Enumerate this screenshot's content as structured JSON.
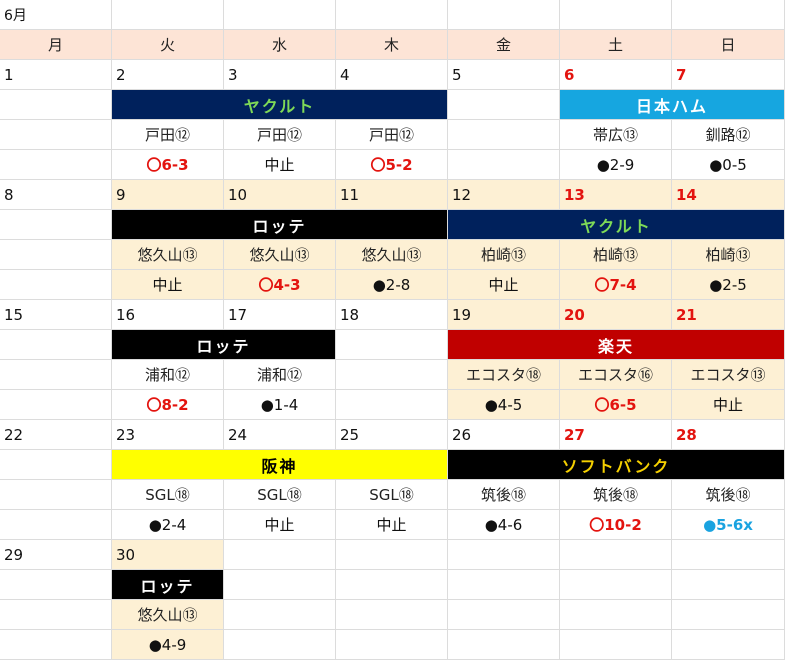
{
  "month_label": "6月",
  "weekdays": [
    "月",
    "火",
    "水",
    "木",
    "金",
    "土",
    "日"
  ],
  "colors": {
    "header_bg": "#fde4d6",
    "home_bg": "#fdf0d4",
    "weekend_date": "#e3140f",
    "win": "#e3140f",
    "loss": "#111111",
    "special": "#1aa3e0"
  },
  "weeks": [
    {
      "dates": [
        {
          "day": "1",
          "weekend": false,
          "home": false
        },
        {
          "day": "2",
          "weekend": false,
          "home": false
        },
        {
          "day": "3",
          "weekend": false,
          "home": false
        },
        {
          "day": "4",
          "weekend": false,
          "home": false
        },
        {
          "day": "5",
          "weekend": false,
          "home": false
        },
        {
          "day": "6",
          "weekend": true,
          "home": false
        },
        {
          "day": "7",
          "weekend": true,
          "home": false
        }
      ],
      "bands": [
        {
          "start": 1,
          "span": 3,
          "name": "ヤクルト",
          "bg": "#00215c",
          "fg": "#7ed957"
        },
        {
          "start": 5,
          "span": 2,
          "name": "日本ハム",
          "bg": "#16a6e0",
          "fg": "#ffffff"
        }
      ],
      "games": [
        {
          "col": 1,
          "venue": "戸田⑫",
          "result": "〇6-3",
          "kind": "win",
          "home": false
        },
        {
          "col": 2,
          "venue": "戸田⑫",
          "result": "中止",
          "kind": "stop",
          "home": false
        },
        {
          "col": 3,
          "venue": "戸田⑫",
          "result": "〇5-2",
          "kind": "win",
          "home": false
        },
        {
          "col": 5,
          "venue": "帯広⑬",
          "result": "●2-9",
          "kind": "loss",
          "home": false
        },
        {
          "col": 6,
          "venue": "釧路⑫",
          "result": "●0-5",
          "kind": "loss",
          "home": false
        }
      ]
    },
    {
      "dates": [
        {
          "day": "8",
          "weekend": false,
          "home": false
        },
        {
          "day": "9",
          "weekend": false,
          "home": true
        },
        {
          "day": "10",
          "weekend": false,
          "home": true
        },
        {
          "day": "11",
          "weekend": false,
          "home": true
        },
        {
          "day": "12",
          "weekend": false,
          "home": true
        },
        {
          "day": "13",
          "weekend": true,
          "home": true
        },
        {
          "day": "14",
          "weekend": true,
          "home": true
        }
      ],
      "bands": [
        {
          "start": 1,
          "span": 3,
          "name": "ロッテ",
          "bg": "#000000",
          "fg": "#ffffff"
        },
        {
          "start": 4,
          "span": 3,
          "name": "ヤクルト",
          "bg": "#00215c",
          "fg": "#7ed957"
        }
      ],
      "games": [
        {
          "col": 1,
          "venue": "悠久山⑬",
          "result": "中止",
          "kind": "stop",
          "home": true
        },
        {
          "col": 2,
          "venue": "悠久山⑬",
          "result": "〇4-3",
          "kind": "win",
          "home": true
        },
        {
          "col": 3,
          "venue": "悠久山⑬",
          "result": "●2-8",
          "kind": "loss",
          "home": true
        },
        {
          "col": 4,
          "venue": "柏崎⑬",
          "result": "中止",
          "kind": "stop",
          "home": true
        },
        {
          "col": 5,
          "venue": "柏崎⑬",
          "result": "〇7-4",
          "kind": "win",
          "home": true
        },
        {
          "col": 6,
          "venue": "柏崎⑬",
          "result": "●2-5",
          "kind": "loss",
          "home": true
        }
      ]
    },
    {
      "dates": [
        {
          "day": "15",
          "weekend": false,
          "home": false
        },
        {
          "day": "16",
          "weekend": false,
          "home": false
        },
        {
          "day": "17",
          "weekend": false,
          "home": false
        },
        {
          "day": "18",
          "weekend": false,
          "home": false
        },
        {
          "day": "19",
          "weekend": false,
          "home": true
        },
        {
          "day": "20",
          "weekend": true,
          "home": true
        },
        {
          "day": "21",
          "weekend": true,
          "home": true
        }
      ],
      "bands": [
        {
          "start": 1,
          "span": 2,
          "name": "ロッテ",
          "bg": "#000000",
          "fg": "#ffffff"
        },
        {
          "start": 4,
          "span": 3,
          "name": "楽天",
          "bg": "#c00000",
          "fg": "#ffffff"
        }
      ],
      "games": [
        {
          "col": 1,
          "venue": "浦和⑫",
          "result": "〇8-2",
          "kind": "win",
          "home": false
        },
        {
          "col": 2,
          "venue": "浦和⑫",
          "result": "●1-4",
          "kind": "loss",
          "home": false
        },
        {
          "col": 4,
          "venue": "エコスタ⑱",
          "result": "●4-5",
          "kind": "loss",
          "home": true
        },
        {
          "col": 5,
          "venue": "エコスタ⑯",
          "result": "〇6-5",
          "kind": "win",
          "home": true
        },
        {
          "col": 6,
          "venue": "エコスタ⑬",
          "result": "中止",
          "kind": "stop",
          "home": true
        }
      ]
    },
    {
      "dates": [
        {
          "day": "22",
          "weekend": false,
          "home": false
        },
        {
          "day": "23",
          "weekend": false,
          "home": false
        },
        {
          "day": "24",
          "weekend": false,
          "home": false
        },
        {
          "day": "25",
          "weekend": false,
          "home": false
        },
        {
          "day": "26",
          "weekend": false,
          "home": false
        },
        {
          "day": "27",
          "weekend": true,
          "home": false
        },
        {
          "day": "28",
          "weekend": true,
          "home": false
        }
      ],
      "bands": [
        {
          "start": 1,
          "span": 3,
          "name": "阪神",
          "bg": "#ffff00",
          "fg": "#000000"
        },
        {
          "start": 4,
          "span": 3,
          "name": "ソフトバンク",
          "bg": "#000000",
          "fg": "#f5d000"
        }
      ],
      "games": [
        {
          "col": 1,
          "venue": "SGL⑱",
          "result": "●2-4",
          "kind": "loss",
          "home": false
        },
        {
          "col": 2,
          "venue": "SGL⑱",
          "result": "中止",
          "kind": "stop",
          "home": false
        },
        {
          "col": 3,
          "venue": "SGL⑱",
          "result": "中止",
          "kind": "stop",
          "home": false
        },
        {
          "col": 4,
          "venue": "筑後⑱",
          "result": "●4-6",
          "kind": "loss",
          "home": false
        },
        {
          "col": 5,
          "venue": "筑後⑱",
          "result": "〇10-2",
          "kind": "win",
          "home": false
        },
        {
          "col": 6,
          "venue": "筑後⑱",
          "result": "●5-6x",
          "kind": "blue",
          "home": false
        }
      ]
    },
    {
      "dates": [
        {
          "day": "29",
          "weekend": false,
          "home": false
        },
        {
          "day": "30",
          "weekend": false,
          "home": true
        },
        {
          "day": "",
          "weekend": false,
          "home": false
        },
        {
          "day": "",
          "weekend": false,
          "home": false
        },
        {
          "day": "",
          "weekend": false,
          "home": false
        },
        {
          "day": "",
          "weekend": false,
          "home": false
        },
        {
          "day": "",
          "weekend": false,
          "home": false
        }
      ],
      "bands": [
        {
          "start": 1,
          "span": 1,
          "name": "ロッテ",
          "bg": "#000000",
          "fg": "#ffffff"
        }
      ],
      "games": [
        {
          "col": 1,
          "venue": "悠久山⑬",
          "result": "●4-9",
          "kind": "loss",
          "home": true
        }
      ]
    }
  ]
}
